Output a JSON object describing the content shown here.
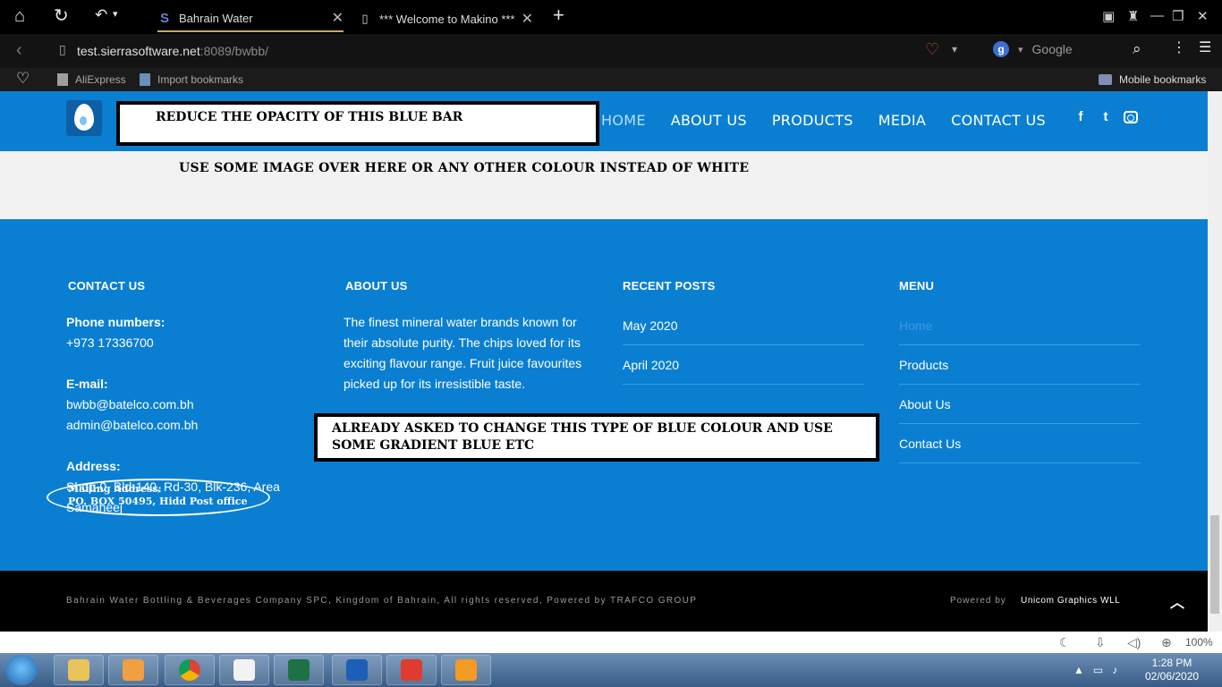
{
  "browser": {
    "tabs": [
      {
        "title": "Bahrain Water",
        "active": true
      },
      {
        "title": "*** Welcome to Makino ***",
        "active": false
      }
    ],
    "url_host": "test.sierrasoftware.net",
    "url_rest": ":8089/bwbb/",
    "search_engine": "Google",
    "bookmarks": [
      "AliExpress",
      "Import bookmarks"
    ],
    "mobile_bookmarks": "Mobile bookmarks",
    "zoom": "100%"
  },
  "site": {
    "nav": [
      "HOME",
      "ABOUT US",
      "PRODUCTS",
      "MEDIA",
      "CONTACT US"
    ],
    "accent_color": "#0a7fd1",
    "annotations": {
      "blue_bar": "REDUCE THE OPACITY OF THIS BLUE BAR",
      "white_area": "USE SOME IMAGE OVER HERE OR ANY OTHER COLOUR INSTEAD OF WHITE",
      "gradient_line1": "ALREADY ASKED TO CHANGE THIS TYPE OF BLUE COLOUR AND USE",
      "gradient_line2": "SOME GRADIENT BLUE ETC",
      "mailing_line1": "Mailing Address:",
      "mailing_line2": "PO. BOX 50495, Hidd Post office"
    },
    "footer": {
      "contact": {
        "title": "CONTACT US",
        "phone_label": "Phone numbers:",
        "phone": "+973 17336700",
        "email_label": "E-mail:",
        "email1": "bwbb@batelco.com.bh",
        "email2": "admin@batelco.com.bh",
        "address_label": "Address:",
        "address_line1": "Shop-0, Bld-140, Rd-30, Blk-236, Area",
        "address_line2": "Samaheej"
      },
      "about": {
        "title": "ABOUT US",
        "text": "The finest mineral water brands known for their absolute purity. The chips loved for its exciting flavour range. Fruit juice favourites picked up for its irresistible taste."
      },
      "recent_posts": {
        "title": "RECENT POSTS",
        "items": [
          "May 2020",
          "April 2020"
        ]
      },
      "menu": {
        "title": "MENU",
        "items": [
          "Home",
          "Products",
          "About Us",
          "Contact Us"
        ]
      }
    },
    "bottom": {
      "copyright": "Bahrain Water Bottling & Beverages Company SPC, Kingdom of Bahrain, All rights reserved, Powered by TRAFCO GROUP",
      "powered_by": "Powered by",
      "company": "Unicom Graphics WLL"
    }
  },
  "taskbar": {
    "time": "1:28 PM",
    "date": "02/06/2020"
  }
}
